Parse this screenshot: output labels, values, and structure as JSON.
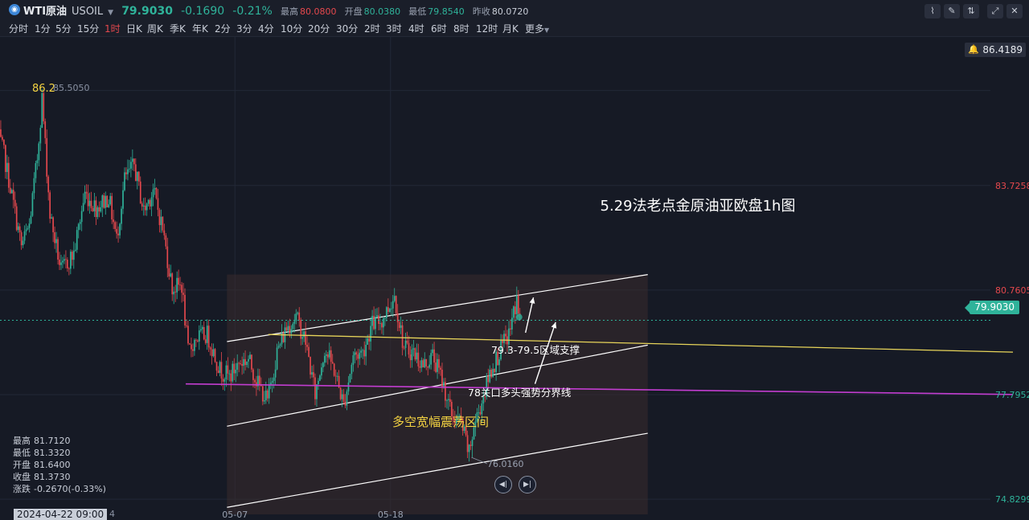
{
  "header": {
    "symbol_icon": "wti-logo-icon",
    "symbol_name": "WTI原油",
    "symbol_code": "USOIL",
    "last_price": "79.9030",
    "change": "-0.1690",
    "change_pct": "-0.21%",
    "high_label": "最高",
    "high_value": "80.0800",
    "open_label": "开盘",
    "open_value": "80.0380",
    "low_label": "最低",
    "low_value": "79.8540",
    "prev_label": "昨收",
    "prev_value": "80.0720",
    "tools": [
      "drawing-tool-icon",
      "pencil-icon",
      "compare-icon",
      "expand-icon",
      "close-icon"
    ]
  },
  "timeframes": {
    "items": [
      "分时",
      "1分",
      "5分",
      "15分",
      "1时",
      "日K",
      "周K",
      "季K",
      "年K",
      "2分",
      "3分",
      "4分",
      "10分",
      "20分",
      "30分",
      "2时",
      "3时",
      "4时",
      "6时",
      "8时",
      "12时",
      "月K",
      "更多"
    ],
    "active": "1时"
  },
  "ohlc_panel": {
    "high_label": "最高",
    "high": "81.7120",
    "low_label": "最低",
    "low": "81.3320",
    "open_label": "开盘",
    "open": "81.6400",
    "close_label": "收盘",
    "close": "81.3730",
    "change_label": "涨跌",
    "change": "-0.2670(-0.33%)"
  },
  "crosshair_time": "2024-04-22 09:00",
  "alert_price": "86.4189",
  "current_price_tag": "79.9030",
  "colors": {
    "background": "#161a25",
    "up": "#2fb39a",
    "down": "#e5484d",
    "support_line": "#e8d55a",
    "boundary_line": "#c23dd0",
    "channel": "#ffffff",
    "annotation_yellow": "#f5d442"
  },
  "chart_data": {
    "type": "candlestick",
    "title": "5.29法老点金原油亚欧盘1h图",
    "ylim": [
      74.4,
      87.8
    ],
    "y_ticks": [
      {
        "value": 86.4189,
        "label": "86.4189",
        "color": "#e5484d"
      },
      {
        "value": 83.7258,
        "label": "83.7258",
        "color": "#e5484d"
      },
      {
        "value": 80.7605,
        "label": "80.7605",
        "color": "#e5484d"
      },
      {
        "value": 77.7952,
        "label": "77.7952",
        "color": "#2fb39a"
      },
      {
        "value": 74.8299,
        "label": "74.8299",
        "color": "#2fb39a"
      }
    ],
    "x_ticks": [
      {
        "bar": 150,
        "label": "05-07"
      },
      {
        "bar": 248,
        "label": "05-18"
      }
    ],
    "num_bars": 330,
    "anchors": [
      [
        0,
        85.2
      ],
      [
        4,
        84.6
      ],
      [
        10,
        83.2
      ],
      [
        15,
        82.0
      ],
      [
        20,
        82.6
      ],
      [
        25,
        84.5
      ],
      [
        28,
        86.2
      ],
      [
        33,
        82.9
      ],
      [
        40,
        81.3
      ],
      [
        48,
        81.8
      ],
      [
        55,
        83.5
      ],
      [
        62,
        83.1
      ],
      [
        70,
        83.4
      ],
      [
        75,
        82.2
      ],
      [
        80,
        83.9
      ],
      [
        86,
        84.3
      ],
      [
        92,
        83.0
      ],
      [
        98,
        83.6
      ],
      [
        104,
        82.5
      ],
      [
        110,
        80.8
      ],
      [
        116,
        80.9
      ],
      [
        120,
        79.0
      ],
      [
        125,
        79.4
      ],
      [
        132,
        79.5
      ],
      [
        140,
        78.5
      ],
      [
        146,
        78.3
      ],
      [
        152,
        78.7
      ],
      [
        158,
        78.8
      ],
      [
        164,
        78.1
      ],
      [
        170,
        77.6
      ],
      [
        176,
        79.0
      ],
      [
        182,
        79.7
      ],
      [
        188,
        80.0
      ],
      [
        194,
        79.3
      ],
      [
        200,
        77.8
      ],
      [
        206,
        79.1
      ],
      [
        212,
        78.5
      ],
      [
        218,
        77.5
      ],
      [
        224,
        78.9
      ],
      [
        230,
        79.0
      ],
      [
        236,
        79.8
      ],
      [
        242,
        79.9
      ],
      [
        250,
        80.6
      ],
      [
        256,
        79.1
      ],
      [
        262,
        79.0
      ],
      [
        268,
        78.6
      ],
      [
        274,
        78.9
      ],
      [
        280,
        78.2
      ],
      [
        286,
        77.2
      ],
      [
        292,
        77.0
      ],
      [
        297,
        76.1
      ],
      [
        300,
        76.9
      ],
      [
        305,
        77.6
      ],
      [
        310,
        78.4
      ],
      [
        316,
        79.0
      ],
      [
        322,
        79.5
      ],
      [
        327,
        80.5
      ],
      [
        329,
        79.9
      ]
    ],
    "extremes": [
      {
        "bar": 28,
        "value": 86.2,
        "label_high": "86.2",
        "label_value": "85.5050"
      },
      {
        "bar": 299,
        "value": 76.016,
        "label": "76.0160"
      }
    ],
    "channel": {
      "range_start_bar": 145,
      "range_end_bar": 410,
      "top_line": [
        [
          145,
          79.3
        ],
        [
          410,
          81.2
        ]
      ],
      "mid_line": [
        [
          145,
          76.9
        ],
        [
          410,
          79.2
        ]
      ],
      "bottom_line": [
        [
          145,
          74.6
        ],
        [
          410,
          76.7
        ]
      ]
    },
    "support_line": {
      "from": [
        171,
        79.5
      ],
      "to": [
        640,
        79.0
      ],
      "label": "79.3-79.5区域支撑"
    },
    "boundary_line": {
      "from": [
        119,
        78.1
      ],
      "to": [
        640,
        77.8
      ],
      "label": "78关口多头强势分界线"
    },
    "zone_label": "多空宽幅震荡区间",
    "arrows": [
      {
        "from": [
          333,
          79.55
        ],
        "to": [
          338,
          80.55
        ]
      },
      {
        "from": [
          339,
          78.1
        ],
        "to": [
          352,
          79.85
        ]
      }
    ]
  }
}
